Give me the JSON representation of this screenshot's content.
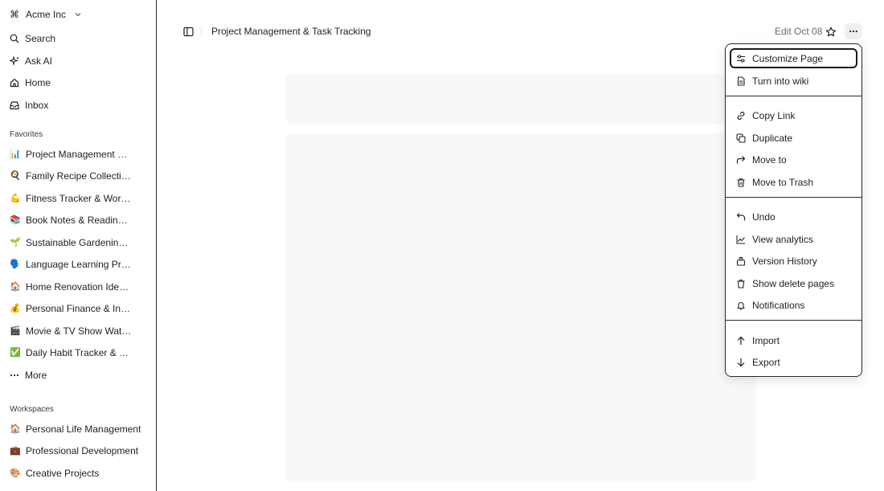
{
  "workspace": {
    "name": "Acme Inc",
    "icon": "command-icon"
  },
  "sidebar": {
    "nav": [
      {
        "label": "Search",
        "icon": "search-icon"
      },
      {
        "label": "Ask AI",
        "icon": "sparkle-icon"
      },
      {
        "label": "Home",
        "icon": "home-icon"
      },
      {
        "label": "Inbox",
        "icon": "inbox-icon"
      }
    ],
    "favorites_label": "Favorites",
    "favorites": [
      {
        "emoji": "📊",
        "label": "Project Management & Task Tracking"
      },
      {
        "emoji": "🍳",
        "label": "Family Recipe Collection & Meal Planning"
      },
      {
        "emoji": "💪",
        "label": "Fitness Tracker & Workout Routines"
      },
      {
        "emoji": "📚",
        "label": "Book Notes & Reading List"
      },
      {
        "emoji": "🌱",
        "label": "Sustainable Gardening Tips & Plans"
      },
      {
        "emoji": "🗣️",
        "label": "Language Learning Progress"
      },
      {
        "emoji": "🏠",
        "label": "Home Renovation Ideas & Budget"
      },
      {
        "emoji": "💰",
        "label": "Personal Finance & Investment"
      },
      {
        "emoji": "🎬",
        "label": "Movie & TV Show Watchlist"
      },
      {
        "emoji": "✅",
        "label": "Daily Habit Tracker & Goals"
      }
    ],
    "more_label": "More",
    "workspaces_label": "Workspaces",
    "workspaces": [
      {
        "emoji": "🏠",
        "label": "Personal Life Management"
      },
      {
        "emoji": "💼",
        "label": "Professional Development"
      },
      {
        "emoji": "🎨",
        "label": "Creative Projects"
      }
    ]
  },
  "header": {
    "title": "Project Management & Task Tracking",
    "edit_date": "Edit Oct 08"
  },
  "menu": {
    "items": [
      {
        "label": "Customize Page",
        "icon": "sliders-icon",
        "focused": true
      },
      {
        "label": "Turn into wiki",
        "icon": "document-icon"
      },
      {
        "label": "Copy Link",
        "icon": "link-icon"
      },
      {
        "label": "Duplicate",
        "icon": "copy-icon"
      },
      {
        "label": "Move to",
        "icon": "arrow-forward-icon"
      },
      {
        "label": "Move to Trash",
        "icon": "trash-icon"
      },
      {
        "label": "Undo",
        "icon": "undo-icon"
      },
      {
        "label": "View analytics",
        "icon": "chart-line-icon"
      },
      {
        "label": "Version History",
        "icon": "layers-icon"
      },
      {
        "label": "Show delete pages",
        "icon": "trash-icon"
      },
      {
        "label": "Notifications",
        "icon": "bell-icon"
      },
      {
        "label": "Import",
        "icon": "arrow-up-icon"
      },
      {
        "label": "Export",
        "icon": "arrow-down-icon"
      }
    ]
  }
}
